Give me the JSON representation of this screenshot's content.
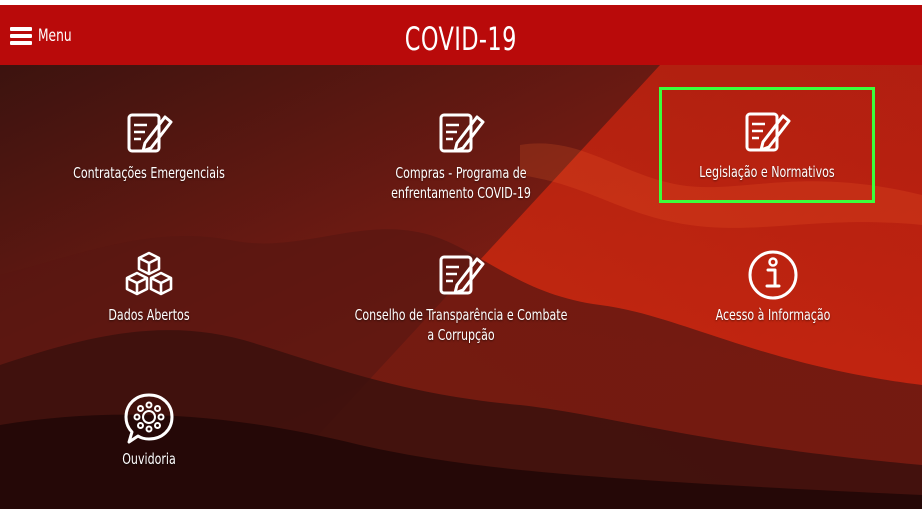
{
  "header": {
    "menu_label": "Menu",
    "title": "COVID-19"
  },
  "tiles": [
    {
      "label": "Contratações Emergenciais",
      "icon": "document-edit-icon"
    },
    {
      "label": "Compras - Programa de enfrentamento COVID-19",
      "icon": "document-edit-icon"
    },
    {
      "label": "Legislação e Normativos",
      "icon": "document-edit-icon",
      "focused": true
    },
    {
      "label": "Dados Abertos",
      "icon": "cubes-icon"
    },
    {
      "label": "Conselho de Transparência e Combate a Corrupção",
      "icon": "document-edit-icon"
    },
    {
      "label": "Acesso à Informação",
      "icon": "info-icon"
    },
    {
      "label": "Ouvidoria",
      "icon": "chat-bubble-icon"
    }
  ],
  "colors": {
    "header_bg": "#b90a0a",
    "focus_outline": "#3bff3b",
    "text": "#ffffff"
  }
}
